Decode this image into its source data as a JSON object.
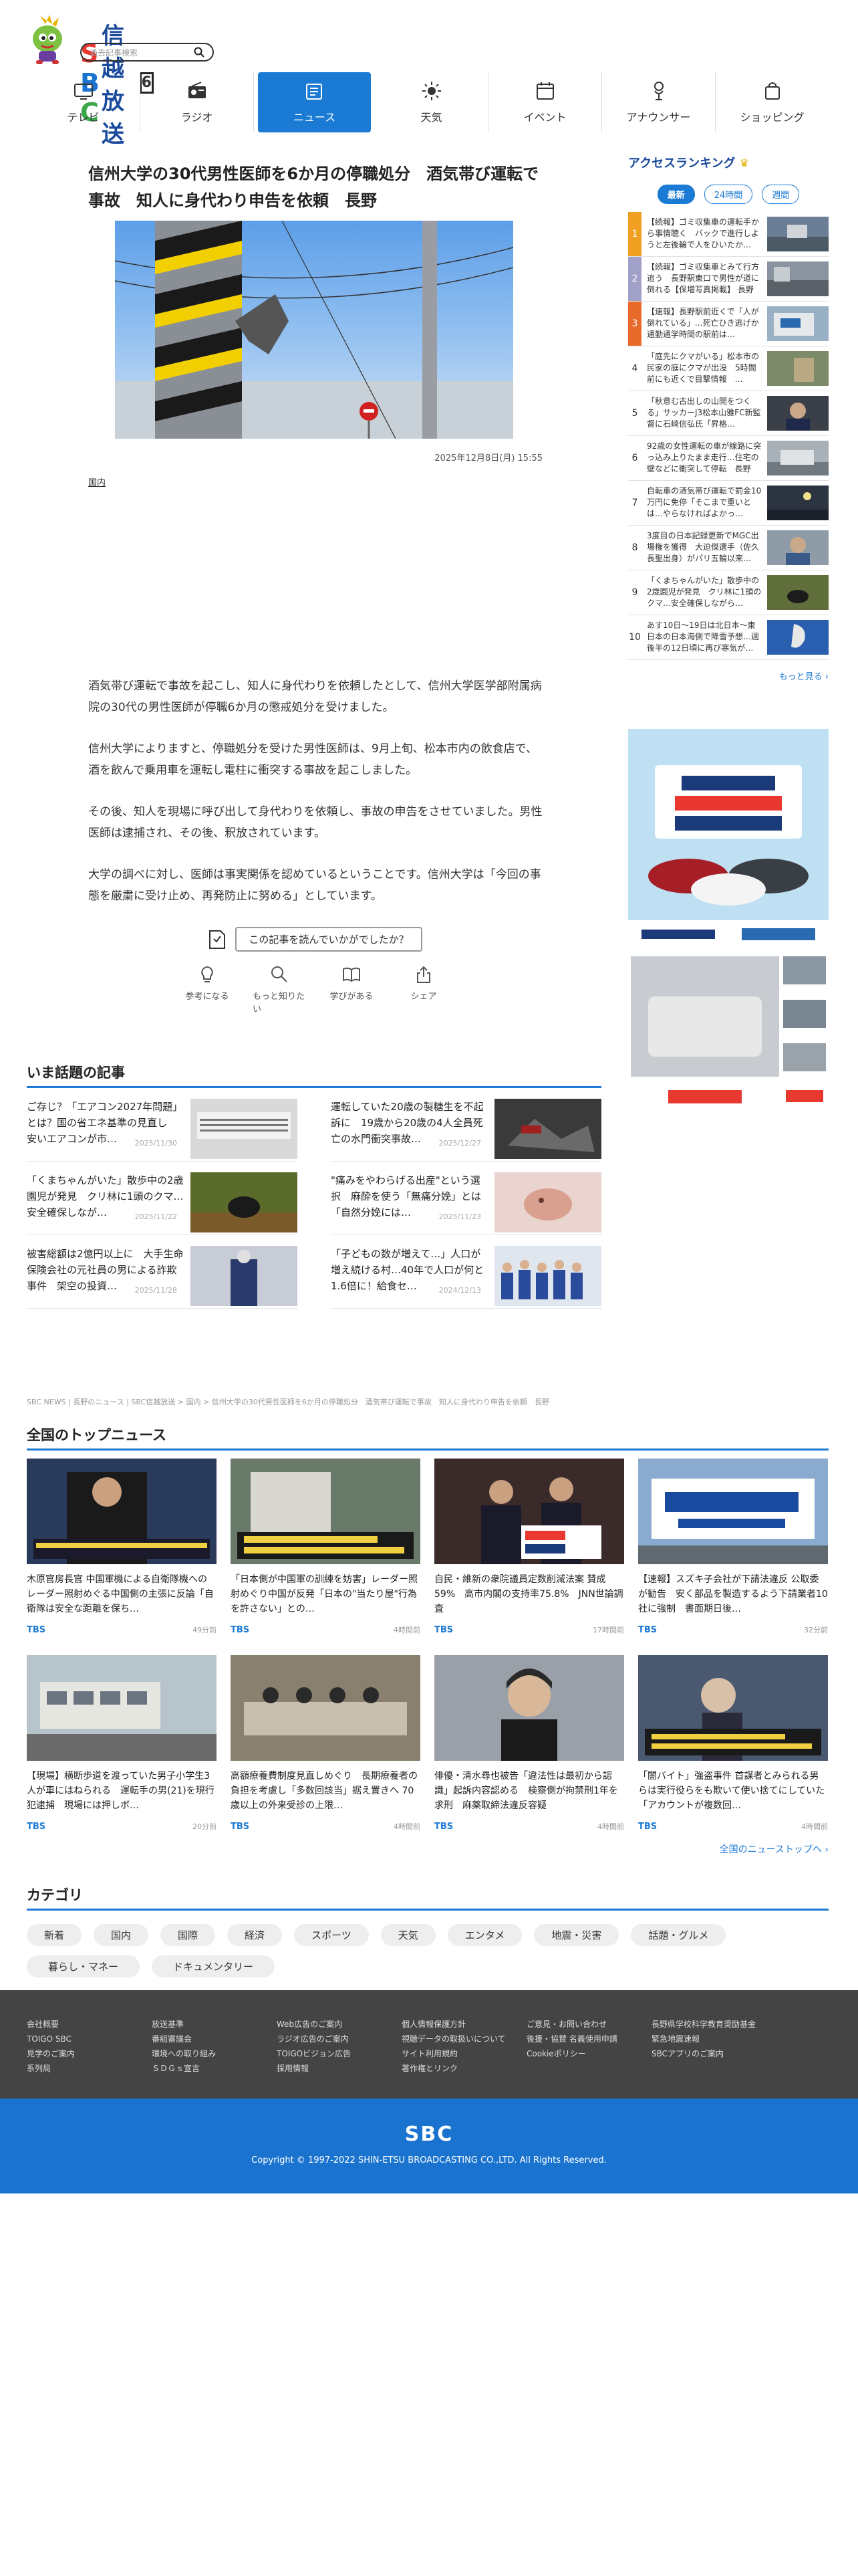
{
  "header": {
    "brand_latin": "SBC",
    "brand_jp": "信越放送",
    "channel": "6",
    "search_placeholder": "過去記事検索"
  },
  "nav": [
    {
      "label": "テレビ",
      "icon": "tv-icon"
    },
    {
      "label": "ラジオ",
      "icon": "radio-icon"
    },
    {
      "label": "ニュース",
      "icon": "news-icon",
      "active": true
    },
    {
      "label": "天気",
      "icon": "sun-icon"
    },
    {
      "label": "イベント",
      "icon": "calendar-icon"
    },
    {
      "label": "アナウンサー",
      "icon": "microphone-icon"
    },
    {
      "label": "ショッピング",
      "icon": "shopping-bag-icon"
    }
  ],
  "article": {
    "title": "信州大学の30代男性医師を6か月の停職処分　酒気帯び運転で事故　知人に身代わり申告を依頼　長野",
    "date": "2025年12月8日(月) 15:55",
    "tag": "国内",
    "paragraphs": [
      "酒気帯び運転で事故を起こし、知人に身代わりを依頼したとして、信州大学医学部附属病院の30代の男性医師が停職6か月の懲戒処分を受けました。",
      "信州大学によりますと、停職処分を受けた男性医師は、9月上旬、松本市内の飲食店で、酒を飲んで乗用車を運転し電柱に衝突する事故を起こしました。",
      "その後、知人を現場に呼び出して身代わりを依頼し、事故の申告をさせていました。男性医師は逮捕され、その後、釈放されています。",
      "大学の調べに対し、医師は事実関係を認めているということです。信州大学は「今回の事態を厳粛に受け止め、再発防止に努める」としています。"
    ],
    "feedback_question": "この記事を読んでいかがでしたか？",
    "feedback": [
      "参考になる",
      "もっと知りたい",
      "学びがある",
      "シェア"
    ]
  },
  "sidebar": {
    "title": "アクセスランキング",
    "tabs": [
      "最新",
      "24時間",
      "週間"
    ],
    "ranking": [
      {
        "num": "1",
        "text": "【続報】ゴミ収集車の運転手から事情聴く　バックで進行しようと左後輪で人をひいたか…",
        "color": "#f0a020"
      },
      {
        "num": "2",
        "text": "【続報】ゴミ収集車とみて行方追う　長野駅東口で男性が道に倒れる【保増写真掲載】 長野",
        "color": "#a0a0c8"
      },
      {
        "num": "3",
        "text": "【速報】長野駅前近くで「人が倒れている」…死亡ひき逃げか　通勤通学時間の駅前は…",
        "color": "#e86a2a"
      },
      {
        "num": "4",
        "text": "「庭先にクマがいる」松本市の民家の庭にクマが出没　5時間前にも近くで目撃情報　…",
        "color": ""
      },
      {
        "num": "5",
        "text": "「秋意む古出しの山開をつくる」サッカーJ3松本山雅FC新監督に石崎信弘氏「昇格…",
        "color": ""
      },
      {
        "num": "6",
        "text": "92歳の女性運転の車が線路に突っ込み上りたまま走行…住宅の壁などに衝突して停転　長野",
        "color": ""
      },
      {
        "num": "7",
        "text": "自転車の酒気帯び運転で罰金10万円に免停「そこまで重いとは…やらなければよかっ…",
        "color": ""
      },
      {
        "num": "8",
        "text": "3度目の日本記録更新でMGC出場権を獲得　大迫傑選手（佐久長聖出身）がパリ五輪以来…",
        "color": ""
      },
      {
        "num": "9",
        "text": "「くまちゃんがいた」散歩中の2歳園児が発見　クリ林に1頭のクマ…安全確保しながら…",
        "color": ""
      },
      {
        "num": "10",
        "text": "あす10日〜19日は北日本〜東日本の日本海側で降雪予想…週後半の12日頃に再び寒気が…",
        "color": ""
      }
    ],
    "more": "もっと見る"
  },
  "trending": {
    "title": "いま話題の記事",
    "items": [
      {
        "text": "ご存じ？「エアコン2027年問題」とは？国の省エネ基準の見直し　安いエアコンが市…",
        "date": "2025/11/30"
      },
      {
        "text": "運転していた20歳の製糖生を不起訴に　19歳から20歳の4人全員死亡の水門衝突事故…",
        "date": "2025/12/27"
      },
      {
        "text": "「くまちゃんがいた」散歩中の2歳園児が発見　クリ林に1頭のクマ…安全確保しなが…",
        "date": "2025/11/22"
      },
      {
        "text": "\"痛みをやわらげる出産\"という選択　麻酔を使う「無痛分娩」とは　「自然分娩には…",
        "date": "2025/11/23"
      },
      {
        "text": "被害総額は2億円以上に　大手生命保険会社の元社員の男による詐欺事件　架空の投資…",
        "date": "2025/11/28"
      },
      {
        "text": "「子どもの数が増えて…」人口が増え続ける村…40年で人口が何と1.6倍に！給食セ…",
        "date": "2024/12/13"
      }
    ]
  },
  "breadcrumb": "SBC NEWS | 長野のニュース | SBC信越放送 > 国内 > 信州大学の30代男性医師を6か月の停職処分　酒気帯び運転で事故　知人に身代わり申告を依頼　長野",
  "national": {
    "title": "全国のトップニュース",
    "items": [
      {
        "text": "木原官房長官 中国軍機による自衛隊機へのレーダー照射めぐる中国側の主張に反論「自衛隊は安全な距離を保ち…",
        "src": "TBS",
        "ago": "49分前"
      },
      {
        "text": "「日本側が中国軍の訓練を妨害」レーダー照射めぐり中国が反発「日本の\"当たり屋\"行為を許さない」との…",
        "src": "TBS",
        "ago": "4時間前"
      },
      {
        "text": "自民・維新の衆院議員定数削減法案 賛成59%　高市内閣の支持率75.8%　JNN世論調査",
        "src": "TBS",
        "ago": "17時間前"
      },
      {
        "text": "【速報】スズキ子会社が下請法違反 公取委が勧告　安く部品を製造するよう下請業者10社に強制　書面期日後…",
        "src": "TBS",
        "ago": "32分前"
      },
      {
        "text": "【現場】横断歩道を渡っていた男子小学生3人が車にはねられる　運転手の男(21)を現行犯逮捕　現場には押しボ…",
        "src": "TBS",
        "ago": "20分前"
      },
      {
        "text": "高額療養費制度見直しめぐり　長期療養者の負担を考慮し「多数回該当」据え置きへ 70歳以上の外来受診の上限…",
        "src": "TBS",
        "ago": "4時間前"
      },
      {
        "text": "俳優・清水尋也被告「違法性は最初から認識」起訴内容認める　検察側が拘禁刑1年を求刑　麻薬取締法違反容疑",
        "src": "TBS",
        "ago": "4時間前"
      },
      {
        "text": "「闇バイト」強盗事件 首謀者とみられる男らは実行役らをも欺いて使い捨てにしていた「アカウントが複数回…",
        "src": "TBS",
        "ago": "4時間前"
      }
    ],
    "more": "全国のニューストップへ"
  },
  "category": {
    "title": "カテゴリ",
    "items": [
      "新着",
      "国内",
      "国際",
      "経済",
      "スポーツ",
      "天気",
      "エンタメ",
      "地震・災害",
      "話題・グルメ",
      "暮らし・マネー",
      "ドキュメンタリー"
    ]
  },
  "footer": {
    "cols": [
      [
        "会社概要",
        "TOIGO SBC",
        "見学のご案内",
        "系列局"
      ],
      [
        "放送基準",
        "番組審議会",
        "環境への取り組み",
        "ＳＤＧｓ宣言"
      ],
      [
        "Web広告のご案内",
        "ラジオ広告のご案内",
        "TOIGOビジョン広告",
        "採用情報"
      ],
      [
        "個人情報保護方針",
        "視聴データの取扱いについて",
        "サイト利用規約",
        "著作権とリンク"
      ],
      [
        "ご意見・お問い合わせ",
        "後援・協賛 名義使用申請",
        "Cookieポリシー"
      ],
      [
        "長野県学校科学教育奨励基金",
        "緊急地震速報",
        "SBCアプリのご案内"
      ]
    ],
    "logo": "SBC",
    "copyright": "Copyright © 1997-2022 SHIN-ETSU BROADCASTING CO.,LTD. All Rights Reserved."
  },
  "colors": {
    "accent": "#1b7ad3",
    "footer_dark": "#444444",
    "footer_blue": "#1a74cf"
  }
}
